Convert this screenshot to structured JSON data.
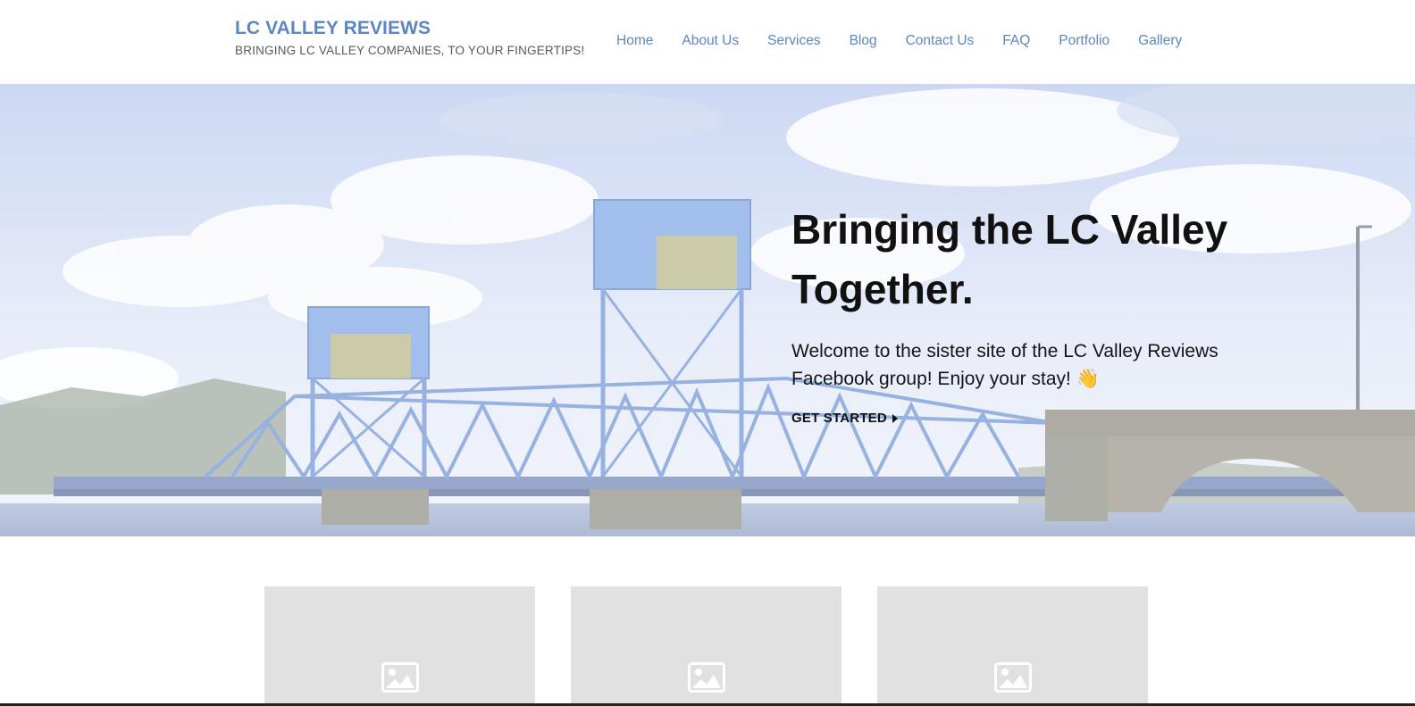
{
  "site": {
    "title": "LC VALLEY REVIEWS",
    "tagline": "BRINGING LC VALLEY COMPANIES, TO YOUR FINGERTIPS!"
  },
  "nav": {
    "items": [
      {
        "label": "Home"
      },
      {
        "label": "About Us"
      },
      {
        "label": "Services"
      },
      {
        "label": "Blog"
      },
      {
        "label": "Contact Us"
      },
      {
        "label": "FAQ"
      },
      {
        "label": "Portfolio"
      },
      {
        "label": "Gallery"
      }
    ]
  },
  "hero": {
    "title": "Bringing the LC Valley Together.",
    "text": "Welcome to the sister site of the LC Valley Reviews Facebook group! Enjoy your stay! 👋",
    "cta_label": "GET STARTED",
    "background": "blue-bridge-river-photo"
  },
  "cards": [
    {
      "icon": "image-placeholder-icon"
    },
    {
      "icon": "image-placeholder-icon"
    },
    {
      "icon": "image-placeholder-icon"
    }
  ],
  "colors": {
    "link": "#5b86c2",
    "hero_text": "#111111",
    "card_bg": "#e1e1e1"
  }
}
